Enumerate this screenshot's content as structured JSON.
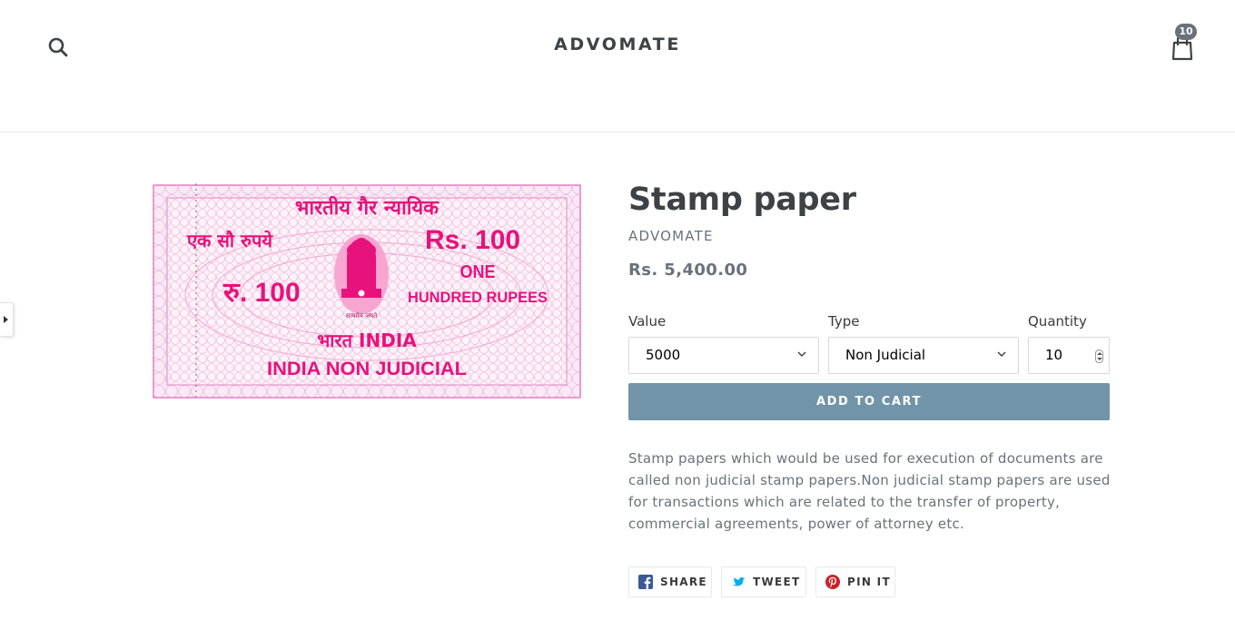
{
  "header": {
    "logo": "ADVOMATE",
    "search_icon": "search-icon",
    "cart_icon": "shopping-bag-icon",
    "cart_count": "10"
  },
  "product": {
    "image_alt": "Stamp paper",
    "image_text": {
      "hindi_top": "भारतीय गैर न्यायिक",
      "hindi_amount": "एक सौ रुपये",
      "rs_amount": "Rs. 100",
      "ru_amount": "रु. 100",
      "one": "ONE",
      "hundred_rupees": "HUNDRED RUPEES",
      "bharat_india": "भारत INDIA",
      "india_non_judicial": "INDIA NON JUDICIAL",
      "emblem_motto": "सत्यमेव जयते"
    },
    "title": "Stamp paper",
    "vendor": "ADVOMATE",
    "price": "Rs. 5,400.00",
    "options": {
      "value_label": "Value",
      "value_selected": "5000",
      "type_label": "Type",
      "type_selected": "Non Judicial",
      "quantity_label": "Quantity",
      "quantity_value": "10"
    },
    "add_to_cart": "ADD TO CART",
    "description": "Stamp papers which would be used for execution of documents are called non judicial stamp papers.Non judicial stamp papers are used for transactions which are related to the transfer of property, commercial agreements, power of attorney etc."
  },
  "share": {
    "facebook": "SHARE",
    "twitter": "TWEET",
    "pinterest": "PIN IT"
  },
  "colors": {
    "button": "#7194a9",
    "stamp_pink": "#e8127c",
    "text_muted": "#69727b"
  }
}
